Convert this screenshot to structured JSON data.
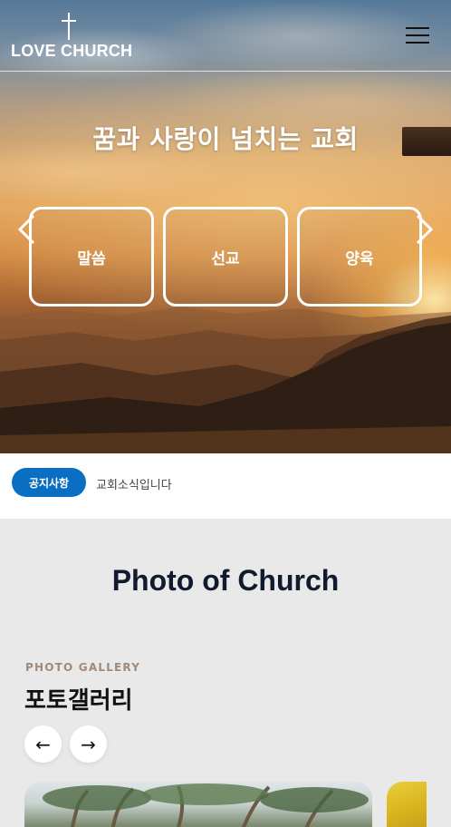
{
  "header": {
    "logo_text": "LOVE CHURCH",
    "menu_icon": "hamburger-menu-icon"
  },
  "hero": {
    "title": "꿈과 사랑이 넘치는 교회",
    "cards": [
      {
        "label": "말씀"
      },
      {
        "label": "선교"
      },
      {
        "label": "양육"
      }
    ],
    "prev_icon": "chevron-left-icon",
    "next_icon": "chevron-right-icon"
  },
  "notice": {
    "badge": "공지사항",
    "text": "교회소식입니다"
  },
  "gallery": {
    "section_title": "Photo of Church",
    "eyebrow": "PHOTO GALLERY",
    "title": "포토갤러리",
    "prev_label": "←",
    "next_label": "→"
  },
  "colors": {
    "accent": "#0a6fc2",
    "section_bg": "#e9e9e9",
    "heading": "#111a2e",
    "eyebrow": "#a08a7a"
  }
}
